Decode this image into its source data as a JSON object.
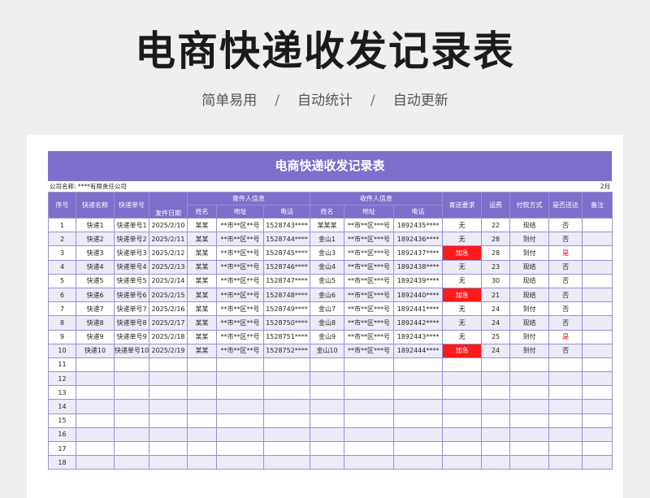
{
  "page": {
    "title": "电商快递收发记录表",
    "subtitle": [
      "简单易用",
      "自动统计",
      "自动更新"
    ],
    "separator": "/"
  },
  "sheet": {
    "banner_title": "电商快递收发记录表",
    "company_label": "公司名称: ****有限责任公司",
    "month_label": "2月",
    "headers": {
      "seq": "序号",
      "express_name": "快递名称",
      "tracking_no": "快递单号",
      "send_date": "发件日期",
      "sender_group": "寄件人信息",
      "sender_name": "姓名",
      "sender_addr": "地址",
      "sender_phone": "电话",
      "receiver_group": "收件人信息",
      "receiver_name": "姓名",
      "receiver_addr": "地址",
      "receiver_phone": "电话",
      "requirement": "寄送要求",
      "freight": "运费",
      "payment": "付款方式",
      "delivered": "是否送达",
      "remark": "备注"
    },
    "rows": [
      {
        "seq": "1",
        "express": "快递1",
        "tracking": "快递单号1",
        "date": "2025/2/10",
        "s_name": "某某",
        "s_addr": "**市**区**号",
        "s_phone": "1528743****",
        "r_name": "某某某",
        "r_addr": "**市**区***号",
        "r_phone": "1892435****",
        "req": "无",
        "fee": "22",
        "pay": "现结",
        "done": "否",
        "remark": ""
      },
      {
        "seq": "2",
        "express": "快递2",
        "tracking": "快递单号2",
        "date": "2025/2/11",
        "s_name": "某某",
        "s_addr": "**市**区**号",
        "s_phone": "1528744****",
        "r_name": "金山1",
        "r_addr": "**市**区***号",
        "r_phone": "1892436****",
        "req": "无",
        "fee": "28",
        "pay": "到付",
        "done": "否",
        "remark": ""
      },
      {
        "seq": "3",
        "express": "快递3",
        "tracking": "快递单号3",
        "date": "2025/2/12",
        "s_name": "某某",
        "s_addr": "**市**区**号",
        "s_phone": "1528745****",
        "r_name": "金山3",
        "r_addr": "**市**区***号",
        "r_phone": "1892437****",
        "req": "加急",
        "fee": "28",
        "pay": "到付",
        "done": "是",
        "remark": ""
      },
      {
        "seq": "4",
        "express": "快递4",
        "tracking": "快递单号4",
        "date": "2025/2/13",
        "s_name": "某某",
        "s_addr": "**市**区**号",
        "s_phone": "1528746****",
        "r_name": "金山4",
        "r_addr": "**市**区***号",
        "r_phone": "1892438****",
        "req": "无",
        "fee": "23",
        "pay": "现结",
        "done": "否",
        "remark": ""
      },
      {
        "seq": "5",
        "express": "快递5",
        "tracking": "快递单号5",
        "date": "2025/2/14",
        "s_name": "某某",
        "s_addr": "**市**区**号",
        "s_phone": "1528747****",
        "r_name": "金山5",
        "r_addr": "**市**区***号",
        "r_phone": "1892439****",
        "req": "无",
        "fee": "30",
        "pay": "现结",
        "done": "否",
        "remark": ""
      },
      {
        "seq": "6",
        "express": "快递6",
        "tracking": "快递单号6",
        "date": "2025/2/15",
        "s_name": "某某",
        "s_addr": "**市**区**号",
        "s_phone": "1528748****",
        "r_name": "金山6",
        "r_addr": "**市**区***号",
        "r_phone": "1892440****",
        "req": "加急",
        "fee": "21",
        "pay": "现结",
        "done": "否",
        "remark": ""
      },
      {
        "seq": "7",
        "express": "快递7",
        "tracking": "快递单号7",
        "date": "2025/2/16",
        "s_name": "某某",
        "s_addr": "**市**区**号",
        "s_phone": "1528749****",
        "r_name": "金山7",
        "r_addr": "**市**区***号",
        "r_phone": "1892441****",
        "req": "无",
        "fee": "24",
        "pay": "到付",
        "done": "否",
        "remark": ""
      },
      {
        "seq": "8",
        "express": "快递8",
        "tracking": "快递单号8",
        "date": "2025/2/17",
        "s_name": "某某",
        "s_addr": "**市**区**号",
        "s_phone": "1528750****",
        "r_name": "金山8",
        "r_addr": "**市**区***号",
        "r_phone": "1892442****",
        "req": "无",
        "fee": "24",
        "pay": "现结",
        "done": "否",
        "remark": ""
      },
      {
        "seq": "9",
        "express": "快递9",
        "tracking": "快递单号9",
        "date": "2025/2/18",
        "s_name": "某某",
        "s_addr": "**市**区**号",
        "s_phone": "1528751****",
        "r_name": "金山9",
        "r_addr": "**市**区***号",
        "r_phone": "1892443****",
        "req": "无",
        "fee": "25",
        "pay": "到付",
        "done": "是",
        "remark": ""
      },
      {
        "seq": "10",
        "express": "快递10",
        "tracking": "快递单号10",
        "date": "2025/2/19",
        "s_name": "某某",
        "s_addr": "**市**区**号",
        "s_phone": "1528752****",
        "r_name": "金山10",
        "r_addr": "**市**区***号",
        "r_phone": "1892444****",
        "req": "加急",
        "fee": "24",
        "pay": "到付",
        "done": "否",
        "remark": ""
      },
      {
        "seq": "11"
      },
      {
        "seq": "12"
      },
      {
        "seq": "13"
      },
      {
        "seq": "14"
      },
      {
        "seq": "15"
      },
      {
        "seq": "16"
      },
      {
        "seq": "17"
      },
      {
        "seq": "18"
      }
    ]
  },
  "colors": {
    "accent": "#7d6fcb",
    "row_alt": "#ecebf8",
    "urgent_bg": "#ff1a1a",
    "delivered_text": "#e00000",
    "urgent_value": "加急",
    "delivered_value": "是"
  }
}
